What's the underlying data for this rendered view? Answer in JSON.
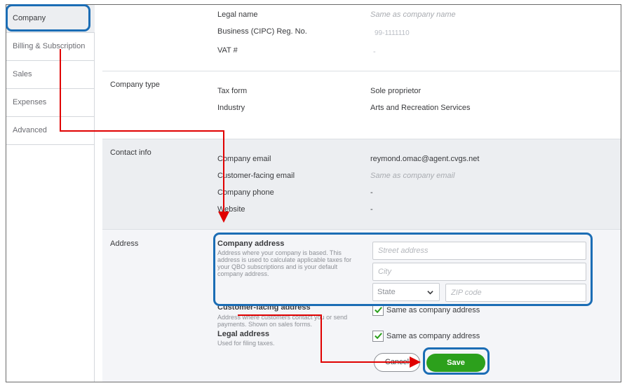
{
  "sidebar": {
    "items": [
      {
        "label": "Company"
      },
      {
        "label": "Billing & Subscription"
      },
      {
        "label": "Sales"
      },
      {
        "label": "Expenses"
      },
      {
        "label": "Advanced"
      }
    ]
  },
  "legal": {
    "legal_name_label": "Legal name",
    "legal_name_value": "Same as company name",
    "reg_label": "Business (CIPC) Reg. No.",
    "reg_value": "99-1111110",
    "vat_label": "VAT #",
    "vat_value": "-"
  },
  "company_type": {
    "title": "Company type",
    "tax_form_label": "Tax form",
    "tax_form_value": "Sole proprietor",
    "industry_label": "Industry",
    "industry_value": "Arts and Recreation Services"
  },
  "contact": {
    "title": "Contact info",
    "email_label": "Company email",
    "email_value": "reymond.omac@agent.cvgs.net",
    "cust_email_label": "Customer-facing email",
    "cust_email_value": "Same as company email",
    "phone_label": "Company phone",
    "phone_value": "-",
    "website_label": "Website",
    "website_value": "-"
  },
  "address": {
    "title": "Address",
    "company_address_title": "Company address",
    "company_address_desc": "Address where your company is based. This address is used to calculate applicable taxes for your QBO subscriptions and is your default company address.",
    "street_placeholder": "Street address",
    "city_placeholder": "City",
    "state_value": "State",
    "zip_placeholder": "ZIP code",
    "customer_address_title": "Customer-facing address",
    "customer_address_desc": "Address where customers contact you or send payments. Shown on sales forms.",
    "customer_same_label": "Same as company address",
    "legal_address_title": "Legal address",
    "legal_address_desc": "Used for filing taxes.",
    "legal_same_label": "Same as company address"
  },
  "actions": {
    "cancel_label": "Cancel",
    "save_label": "Save"
  },
  "colors": {
    "highlight": "#1b6db5",
    "arrow": "#e00000",
    "save": "#2ca01c"
  }
}
